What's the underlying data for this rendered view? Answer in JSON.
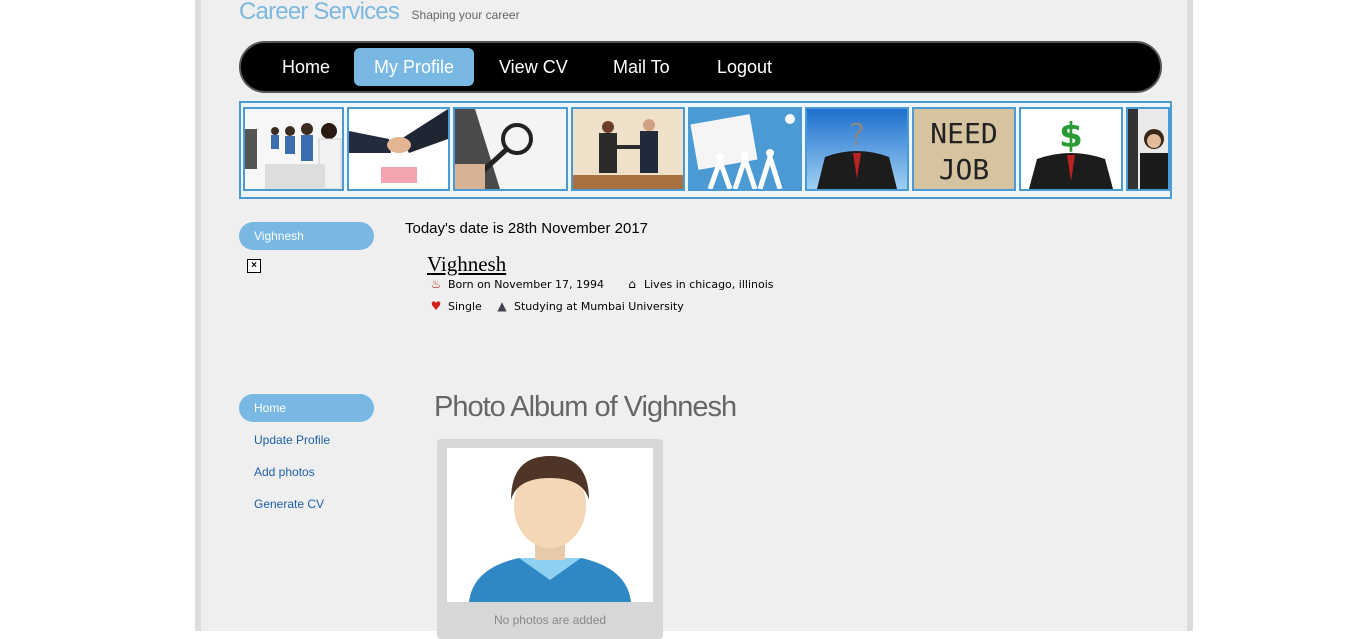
{
  "brand": {
    "title": "Career Services",
    "tagline": "Shaping your career"
  },
  "nav": [
    {
      "label": "Home"
    },
    {
      "label": "My Profile",
      "active": true
    },
    {
      "label": "View CV"
    },
    {
      "label": "Mail To"
    },
    {
      "label": "Logout"
    }
  ],
  "banner": {
    "need_job_text_1": "NEED",
    "need_job_text_2": "JOB",
    "dollar_symbol": "$",
    "question_symbol": "?"
  },
  "sidebar": {
    "user_pill": "Vighnesh",
    "menu": [
      {
        "label": "Home",
        "active": true
      },
      {
        "label": "Update Profile"
      },
      {
        "label": "Add photos"
      },
      {
        "label": "Generate CV"
      }
    ]
  },
  "profile": {
    "date_line": "Today's date is 28th November 2017",
    "name": "Vighnesh",
    "born": "Born on November 17, 1994",
    "lives": "Lives in chicago, illinois",
    "status": "Single",
    "study": "Studying at Mumbai University"
  },
  "album": {
    "title": "Photo Album of Vighnesh",
    "caption": "No photos are added"
  },
  "colors": {
    "accent": "#79b8e3",
    "nav_bg": "#000000",
    "link": "#1d5fa8"
  }
}
